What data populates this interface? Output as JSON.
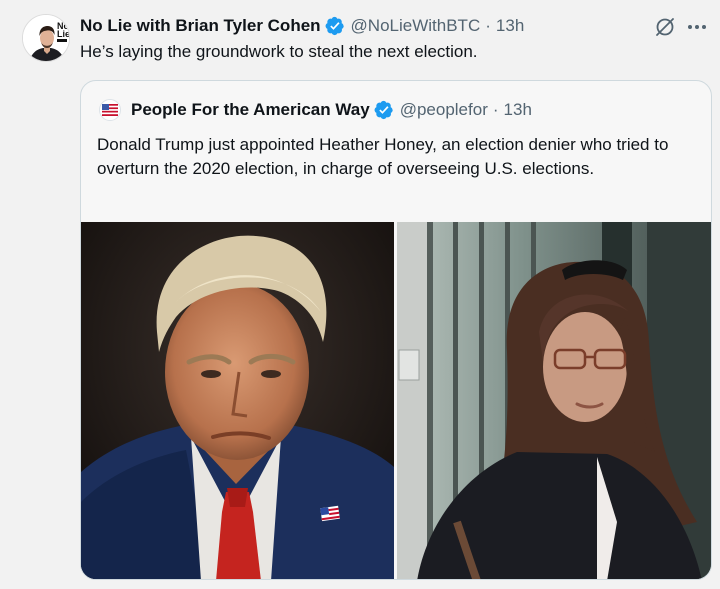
{
  "tweet": {
    "author_name": "No Lie with Brian Tyler Cohen",
    "handle": "@NoLieWithBTC",
    "separator": "·",
    "time": "13h",
    "text": "He’s laying the groundwork to steal the next election.",
    "avatar_label_line1": "No",
    "avatar_label_line2": "Lie"
  },
  "quoted_tweet": {
    "author_name": "People For the American Way",
    "handle": "@peoplefor",
    "separator": "·",
    "time": "13h",
    "text": "Donald Trump just appointed Heather Honey, an election denier who tried to overturn the 2020 election, in charge of overseeing U.S. elections."
  },
  "colors": {
    "verified": "#1d9bf0",
    "secondary_text": "#536471",
    "border": "#cfd9de"
  },
  "icons": [
    "verified-badge-icon",
    "grok-icon",
    "more-icon",
    "flag-icon"
  ]
}
